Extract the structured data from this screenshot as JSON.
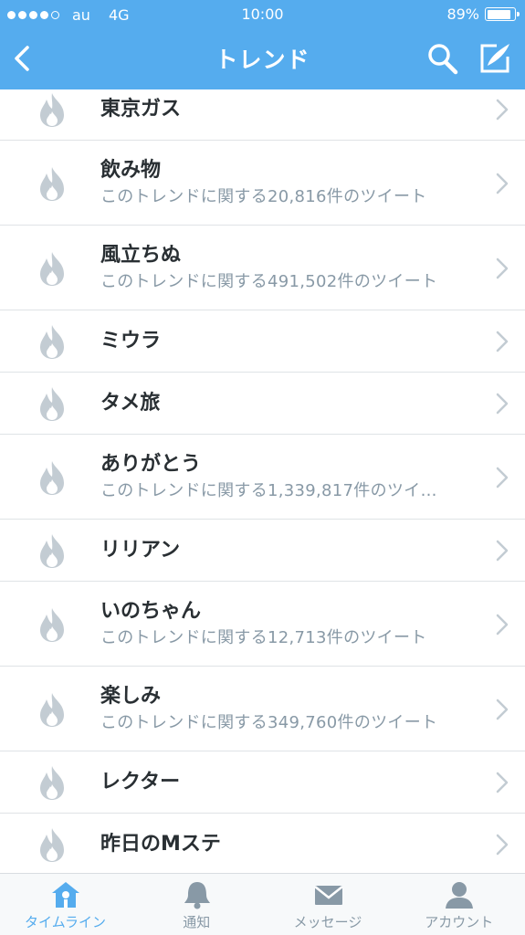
{
  "status_bar": {
    "carrier": "au",
    "network": "4G",
    "time": "10:00",
    "battery": "89%",
    "battery_level": 0.89,
    "signal_bars_filled": 4,
    "signal_bars_total": 5
  },
  "navbar": {
    "title": "トレンド",
    "back_icon": "chevron-left-icon",
    "search_icon": "search-icon",
    "compose_icon": "compose-icon",
    "color": "#55acee"
  },
  "trends": [
    {
      "name": "東京ガス",
      "tweets": ""
    },
    {
      "name": "飲み物",
      "tweets": "このトレンドに関する20,816件のツイート"
    },
    {
      "name": "風立ちぬ",
      "tweets": "このトレンドに関する491,502件のツイート"
    },
    {
      "name": "ミウラ",
      "tweets": ""
    },
    {
      "name": "タメ旅",
      "tweets": ""
    },
    {
      "name": "ありがとう",
      "tweets": "このトレンドに関する1,339,817件のツイ…"
    },
    {
      "name": "リリアン",
      "tweets": ""
    },
    {
      "name": "いのちゃん",
      "tweets": "このトレンドに関する12,713件のツイート"
    },
    {
      "name": "楽しみ",
      "tweets": "このトレンドに関する349,760件のツイート"
    },
    {
      "name": "レクター",
      "tweets": ""
    },
    {
      "name": "昨日のMステ",
      "tweets": ""
    }
  ],
  "tabbar": {
    "tabs": [
      {
        "label": "タイムライン",
        "icon": "home-icon",
        "active": true
      },
      {
        "label": "通知",
        "icon": "bell-icon",
        "active": false
      },
      {
        "label": "メッセージ",
        "icon": "envelope-icon",
        "active": false
      },
      {
        "label": "アカウント",
        "icon": "person-icon",
        "active": false
      }
    ],
    "active_color": "#55acee",
    "inactive_color": "#8899a6"
  }
}
